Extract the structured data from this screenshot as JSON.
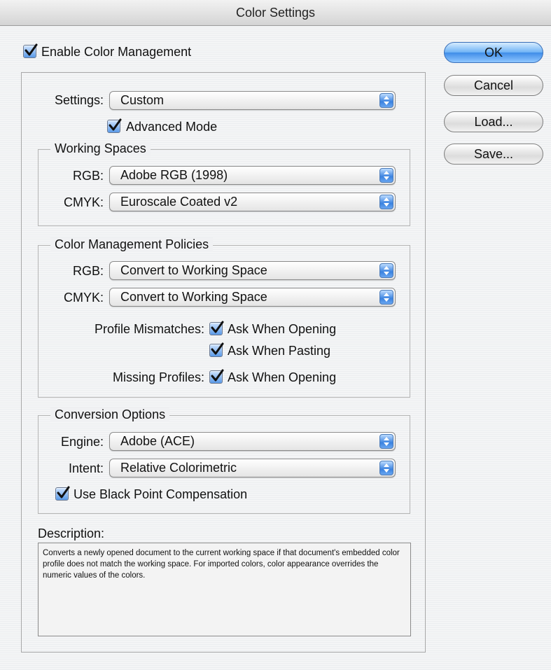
{
  "window": {
    "title": "Color Settings"
  },
  "enable_color_management": {
    "label": "Enable Color Management",
    "checked": true
  },
  "settings": {
    "label": "Settings:",
    "value": "Custom",
    "advanced_mode": {
      "label": "Advanced Mode",
      "checked": true
    }
  },
  "working_spaces": {
    "title": "Working Spaces",
    "rgb": {
      "label": "RGB:",
      "value": "Adobe RGB (1998)"
    },
    "cmyk": {
      "label": "CMYK:",
      "value": "Euroscale Coated v2"
    }
  },
  "policies": {
    "title": "Color Management Policies",
    "rgb": {
      "label": "RGB:",
      "value": "Convert to Working Space"
    },
    "cmyk": {
      "label": "CMYK:",
      "value": "Convert to Working Space"
    },
    "profile_mismatches": {
      "label": "Profile Mismatches:",
      "ask_opening": {
        "label": "Ask When Opening",
        "checked": true
      },
      "ask_pasting": {
        "label": "Ask When Pasting",
        "checked": true
      }
    },
    "missing_profiles": {
      "label": "Missing Profiles:",
      "ask_opening": {
        "label": "Ask When Opening",
        "checked": true
      }
    }
  },
  "conversion": {
    "title": "Conversion Options",
    "engine": {
      "label": "Engine:",
      "value": "Adobe (ACE)"
    },
    "intent": {
      "label": "Intent:",
      "value": "Relative Colorimetric"
    },
    "black_point": {
      "label": "Use Black Point Compensation",
      "checked": true
    }
  },
  "description": {
    "label": "Description:",
    "text": "Converts a newly opened document to the current working space if that document's embedded color profile does not match the working space. For imported colors, color appearance overrides the numeric values of the colors."
  },
  "buttons": {
    "ok": "OK",
    "cancel": "Cancel",
    "load": "Load...",
    "save": "Save..."
  },
  "colors": {
    "accent": "#3f8de8",
    "check": "#111111"
  }
}
